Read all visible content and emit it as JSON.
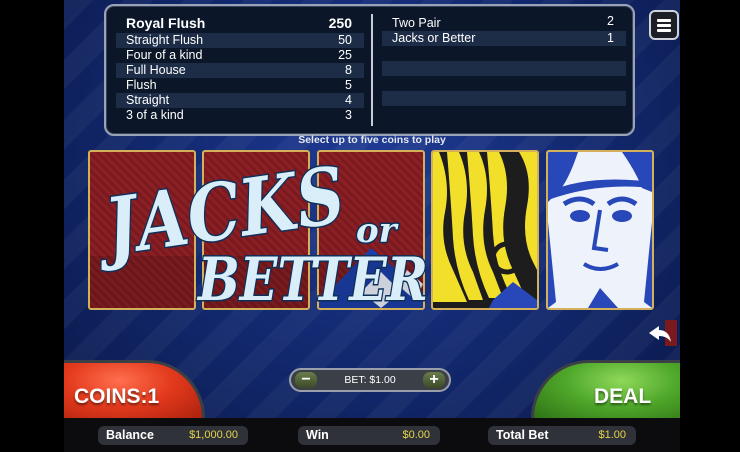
{
  "paytable": {
    "left": [
      {
        "hand": "Royal Flush",
        "payout": "250"
      },
      {
        "hand": "Straight Flush",
        "payout": "50"
      },
      {
        "hand": "Four of a kind",
        "payout": "25"
      },
      {
        "hand": "Full House",
        "payout": "8"
      },
      {
        "hand": "Flush",
        "payout": "5"
      },
      {
        "hand": "Straight",
        "payout": "4"
      },
      {
        "hand": "3 of a kind",
        "payout": "3"
      }
    ],
    "right": [
      {
        "hand": "Two Pair",
        "payout": "2"
      },
      {
        "hand": "Jacks or Better",
        "payout": "1"
      }
    ]
  },
  "hint": "Select up to five coins to play",
  "logo": {
    "line1": "JACKS",
    "line2": "or",
    "line3": "BETTER"
  },
  "cards": [
    "card-back",
    "card-back",
    "card-back",
    "jack-face",
    "jack-face"
  ],
  "bet": {
    "minus": "−",
    "plus": "+",
    "label": "BET: $1.00"
  },
  "coins_button": "COINS:1",
  "deal_button": "DEAL",
  "status": {
    "balance_label": "Balance",
    "balance_value": "$1,000.00",
    "win_label": "Win",
    "win_value": "$0.00",
    "total_bet_label": "Total Bet",
    "total_bet_value": "$1.00"
  },
  "icons": {
    "menu": "hamburger-menu-icon",
    "undo": "undo-arrow-icon"
  },
  "colors": {
    "felt": "#132a72",
    "deal": "#4fa82a",
    "coins": "#e33a1d",
    "accent": "#e8d34a"
  }
}
